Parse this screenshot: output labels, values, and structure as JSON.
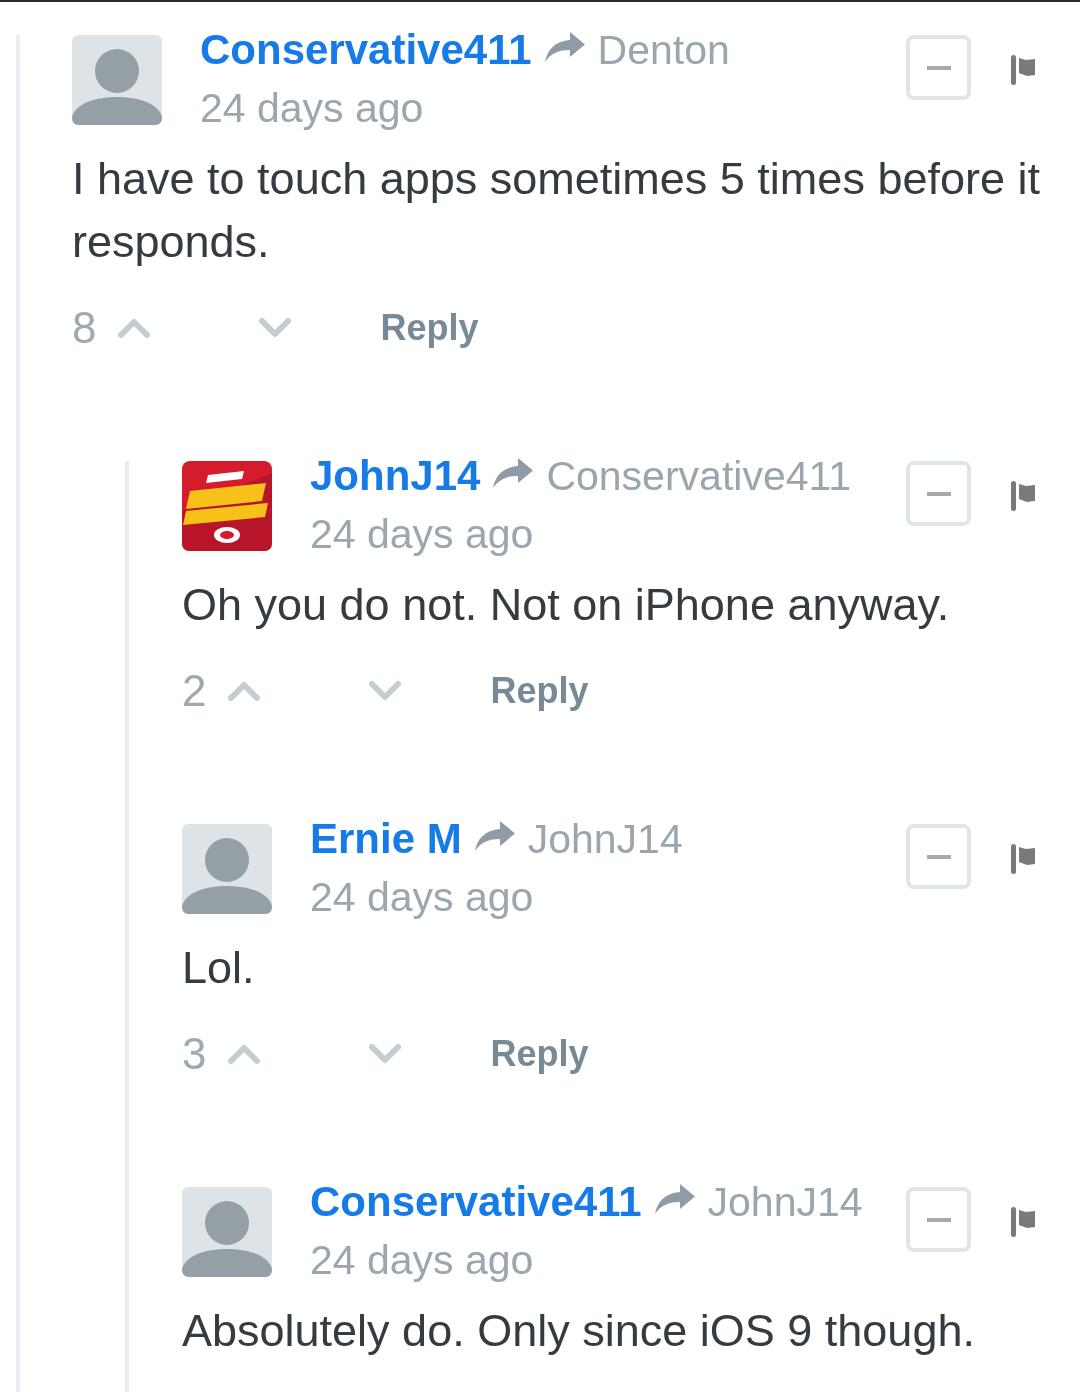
{
  "thread": {
    "comments": [
      {
        "author": "Conservative411",
        "reply_to": "Denton",
        "time": "24 days ago",
        "avatar": {
          "kind": "default"
        },
        "expanded": true,
        "body": "I have to touch apps sometimes 5 times before it responds.",
        "votes": {
          "count": "8"
        },
        "reply_label": "Reply",
        "children": [
          {
            "author": "JohnJ14",
            "reply_to": "Conservative411",
            "time": "24 days ago",
            "avatar": {
              "kind": "logo"
            },
            "expanded": true,
            "body": "Oh you do not. Not on iPhone anyway.",
            "votes": {
              "count": "2"
            },
            "reply_label": "Reply"
          },
          {
            "author": "Ernie M",
            "reply_to": "JohnJ14",
            "time": "24 days ago",
            "avatar": {
              "kind": "default"
            },
            "expanded": true,
            "body": "Lol.",
            "votes": {
              "count": "3"
            },
            "reply_label": "Reply"
          },
          {
            "author": "Conservative411",
            "reply_to": "JohnJ14",
            "time": "24 days ago",
            "avatar": {
              "kind": "default"
            },
            "expanded": true,
            "body": "Absolutely do. Only since iOS 9 though."
          }
        ]
      }
    ]
  }
}
